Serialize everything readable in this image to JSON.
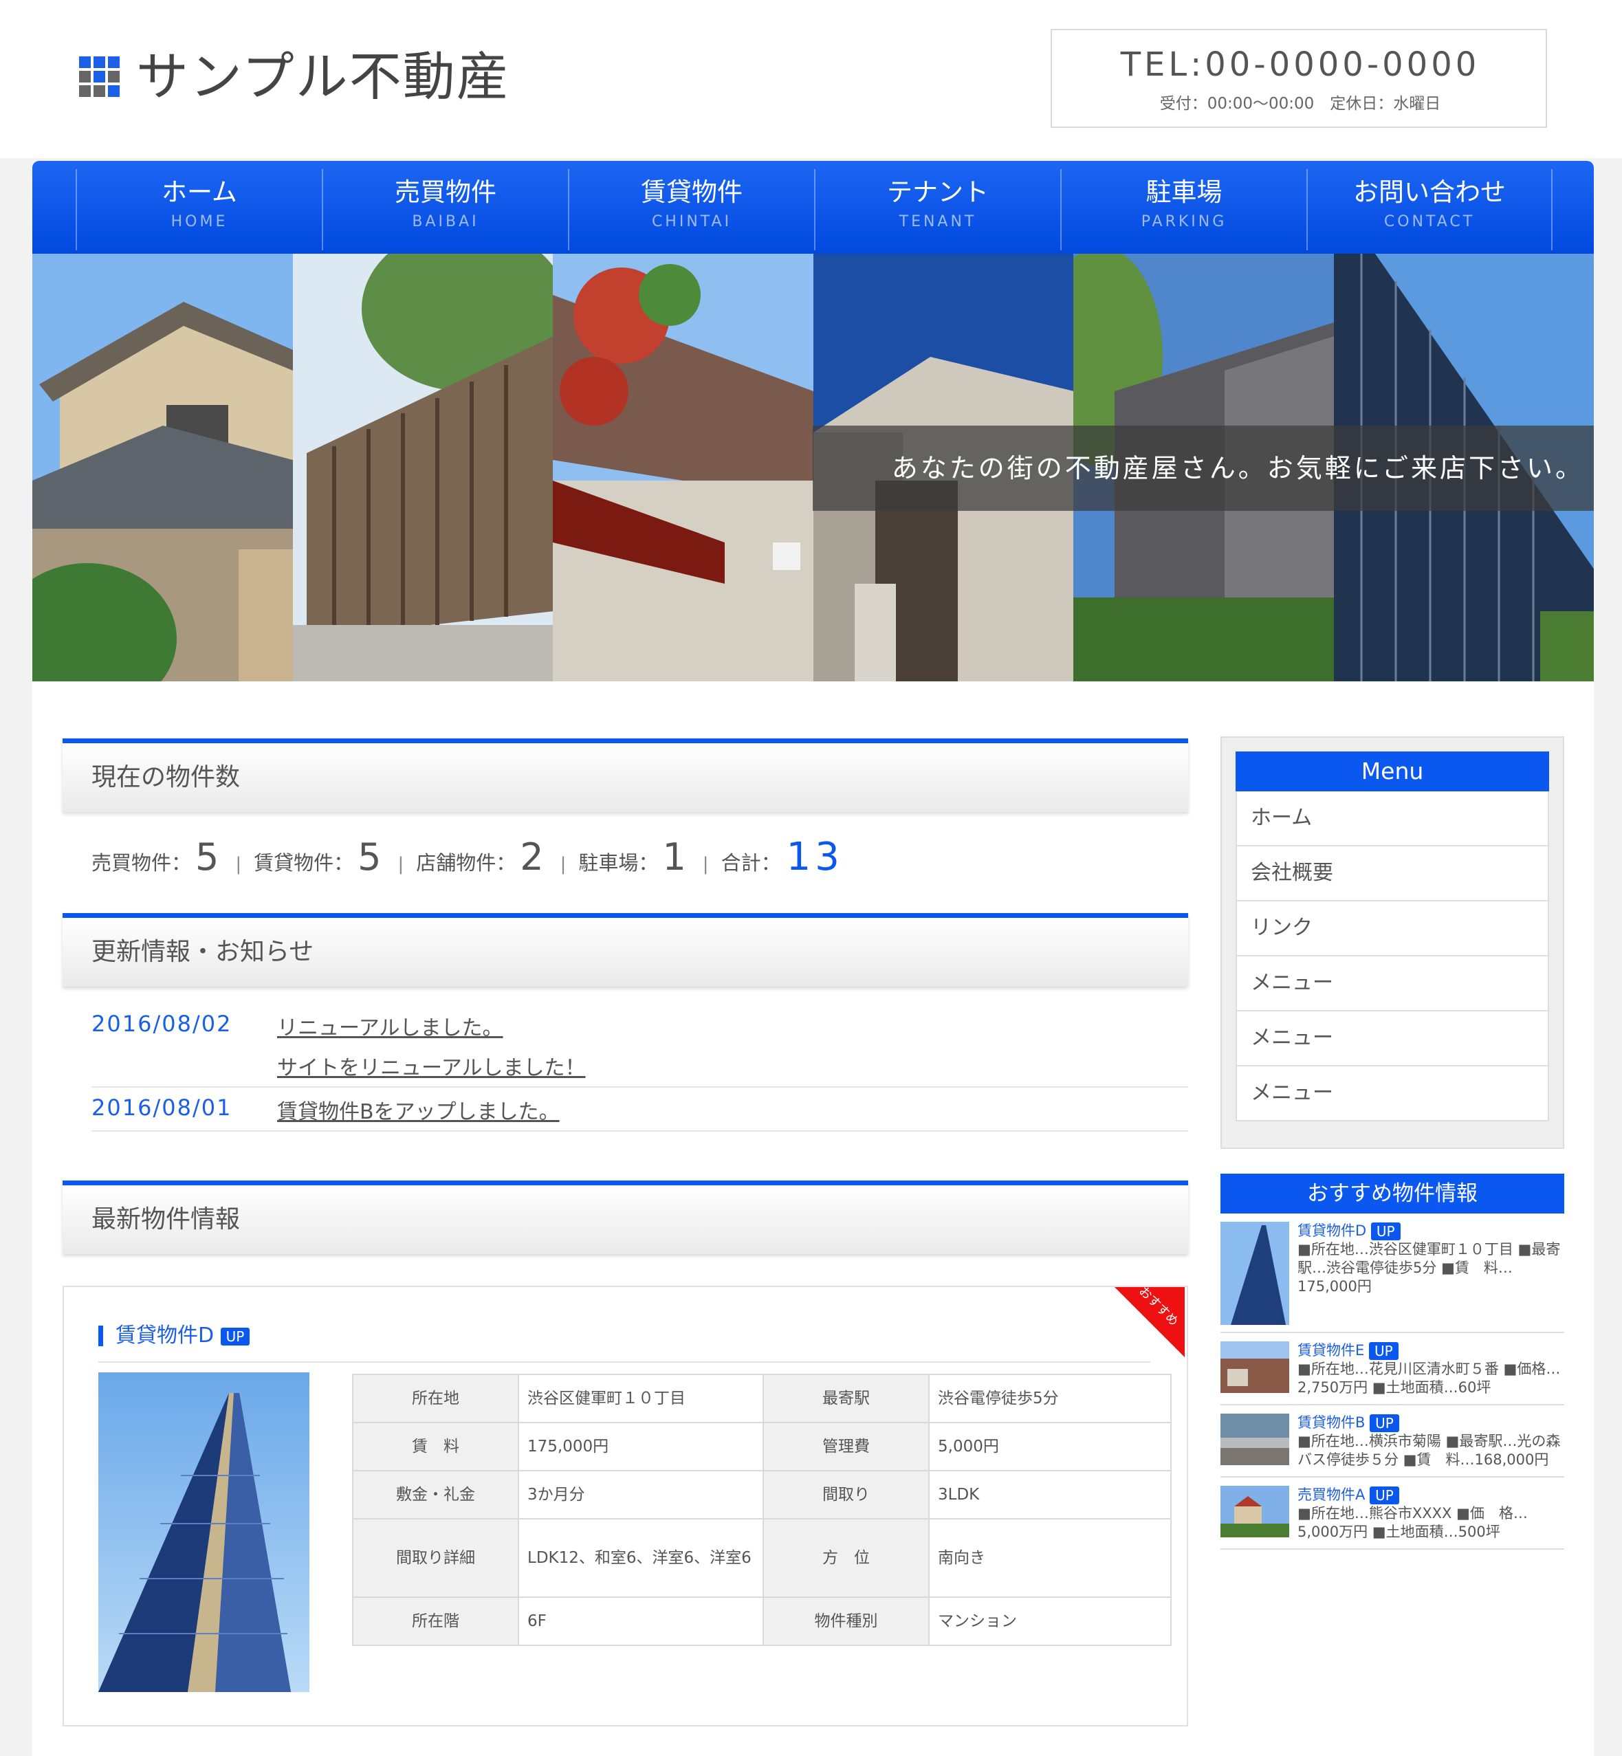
{
  "header": {
    "site_name": "サンプル不動産",
    "tel": "TEL:00-0000-0000",
    "hours": "受付：00:00〜00:00　定休日：水曜日"
  },
  "nav": [
    {
      "jp": "ホーム",
      "en": "HOME"
    },
    {
      "jp": "売買物件",
      "en": "BAIBAI"
    },
    {
      "jp": "賃貸物件",
      "en": "CHINTAI"
    },
    {
      "jp": "テナント",
      "en": "TENANT"
    },
    {
      "jp": "駐車場",
      "en": "PARKING"
    },
    {
      "jp": "お問い合わせ",
      "en": "CONTACT"
    }
  ],
  "hero": {
    "caption": "あなたの街の不動産屋さん。お気軽にご来店下さい。"
  },
  "counts": {
    "title": "現在の物件数",
    "baibai_label": "売買物件：",
    "baibai": "5",
    "chintai_label": "賃貸物件：",
    "chintai": "5",
    "tenpo_label": "店舗物件：",
    "tenpo": "2",
    "parking_label": "駐車場：",
    "parking": "1",
    "total_label": "合計：",
    "total": "13",
    "sep": "|"
  },
  "news": {
    "title": "更新情報・お知らせ",
    "items": [
      {
        "date": "2016/08/02",
        "text": "リニューアルしました。"
      },
      {
        "date": "",
        "text": "サイトをリニューアルしました！"
      },
      {
        "date": "2016/08/01",
        "text": "賃貸物件Bをアップしました。"
      }
    ]
  },
  "latest": {
    "title": "最新物件情報",
    "card": {
      "ribbon": "おすすめ",
      "name": "賃貸物件D",
      "badge": "UP",
      "rows": [
        {
          "k1": "所在地",
          "v1": "渋谷区健軍町１０丁目",
          "k2": "最寄駅",
          "v2": "渋谷電停徒歩5分"
        },
        {
          "k1": "賃　料",
          "v1": "175,000円",
          "k2": "管理費",
          "v2": "5,000円"
        },
        {
          "k1": "敷金・礼金",
          "v1": "3か月分",
          "k2": "間取り",
          "v2": "3LDK"
        },
        {
          "k1": "間取り詳細",
          "v1": "LDK12、和室6、洋室6、洋室6",
          "k2": "方　位",
          "v2": "南向き"
        },
        {
          "k1": "所在階",
          "v1": "6F",
          "k2": "物件種別",
          "v2": "マンション"
        }
      ]
    }
  },
  "sidebar": {
    "menu_title": "Menu",
    "menu": [
      "ホーム",
      "会社概要",
      "リンク",
      "メニュー",
      "メニュー",
      "メニュー"
    ],
    "rec_title": "おすすめ物件情報",
    "rec": [
      {
        "name": "賃貸物件D",
        "badge": "UP",
        "desc": "■所在地…渋谷区健軍町１０丁目 ■最寄駅…渋谷電停徒歩5分 ■賃　料…175,000円"
      },
      {
        "name": "賃貸物件E",
        "badge": "UP",
        "desc": "■所在地…花見川区清水町５番 ■価格…2,750万円 ■土地面積…60坪"
      },
      {
        "name": "賃貸物件B",
        "badge": "UP",
        "desc": "■所在地…横浜市菊陽 ■最寄駅…光の森バス停徒歩５分 ■賃　料…168,000円"
      },
      {
        "name": "売買物件A",
        "badge": "UP",
        "desc": "■所在地…熊谷市XXXX ■価　格…5,000万円 ■土地面積…500坪"
      }
    ]
  },
  "colors": {
    "accent": "#0a58f0",
    "link": "#1b5fe6"
  }
}
